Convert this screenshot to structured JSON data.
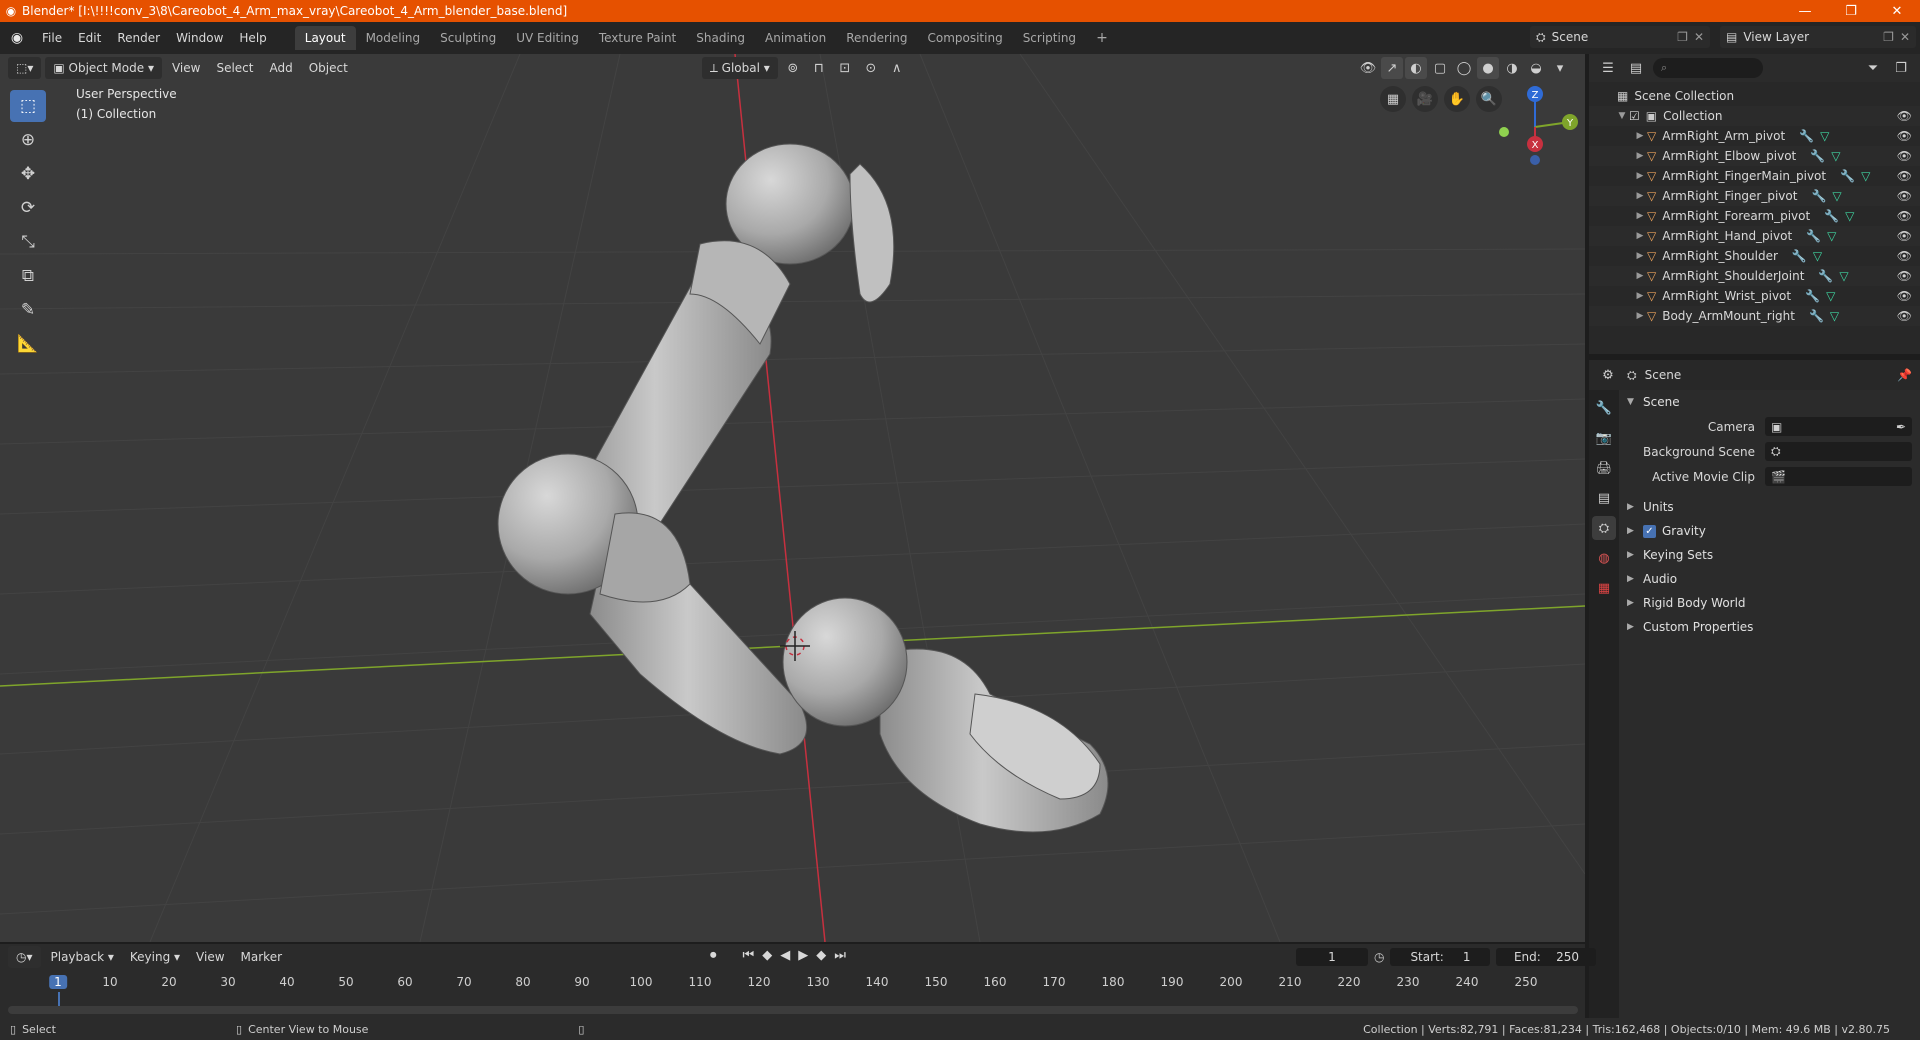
{
  "window": {
    "title": "Blender* [I:\\!!!!conv_3\\8\\Careobot_4_Arm_max_vray\\Careobot_4_Arm_blender_base.blend]",
    "controls": [
      "—",
      "❐",
      "✕"
    ]
  },
  "menu": [
    "File",
    "Edit",
    "Render",
    "Window",
    "Help"
  ],
  "workspaces": [
    "Layout",
    "Modeling",
    "Sculpting",
    "UV Editing",
    "Texture Paint",
    "Shading",
    "Animation",
    "Rendering",
    "Compositing",
    "Scripting"
  ],
  "active_workspace": "Layout",
  "scene_selector": "Scene",
  "view_layer": "View Layer",
  "viewport": {
    "mode": "Object Mode",
    "menus": [
      "View",
      "Select",
      "Add",
      "Object"
    ],
    "transform_orientation": "Global",
    "info_line1": "User Perspective",
    "info_line2": "(1) Collection",
    "gizmo_axes": {
      "x": "X",
      "y": "Y",
      "z": "Z"
    }
  },
  "outliner": {
    "root": "Scene Collection",
    "collection": "Collection",
    "objects": [
      "ArmRight_Arm_pivot",
      "ArmRight_Elbow_pivot",
      "ArmRight_FingerMain_pivot",
      "ArmRight_Finger_pivot",
      "ArmRight_Forearm_pivot",
      "ArmRight_Hand_pivot",
      "ArmRight_Shoulder",
      "ArmRight_ShoulderJoint",
      "ArmRight_Wrist_pivot",
      "Body_ArmMount_right"
    ]
  },
  "properties": {
    "header": "Scene",
    "panel": "Scene",
    "fields": [
      {
        "label": "Camera",
        "value": ""
      },
      {
        "label": "Background Scene",
        "value": ""
      },
      {
        "label": "Active Movie Clip",
        "value": ""
      }
    ],
    "subpanels": [
      "Units",
      "Gravity",
      "Keying Sets",
      "Audio",
      "Rigid Body World",
      "Custom Properties"
    ]
  },
  "timeline": {
    "menus": [
      "Playback",
      "Keying",
      "View",
      "Marker"
    ],
    "current_frame": "1",
    "start_label": "Start:",
    "start": "1",
    "end_label": "End:",
    "end": "250",
    "ruler": [
      "1",
      "10",
      "20",
      "30",
      "40",
      "50",
      "60",
      "70",
      "80",
      "90",
      "100",
      "110",
      "120",
      "130",
      "140",
      "150",
      "160",
      "170",
      "180",
      "190",
      "200",
      "210",
      "220",
      "230",
      "240",
      "250"
    ]
  },
  "statusbar": {
    "left": "Select",
    "middle": "Center View to Mouse",
    "right": "Collection | Verts:82,791 | Faces:81,234 | Tris:162,468 | Objects:0/10 | Mem: 49.6 MB | v2.80.75"
  },
  "colors": {
    "title_bar": "#e65100",
    "accent": "#4772b3",
    "viewport_bg": "#3a3a3a",
    "x_axis": "#c7303f",
    "y_axis": "#7fa52b"
  }
}
